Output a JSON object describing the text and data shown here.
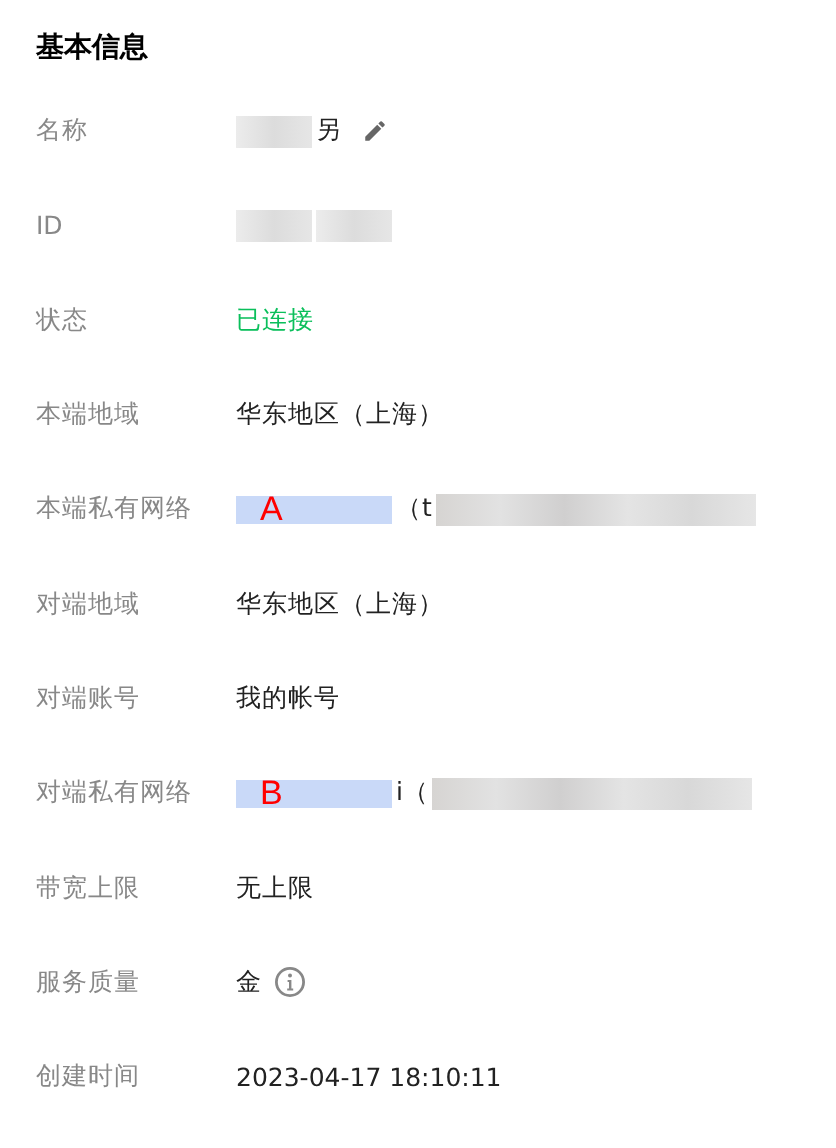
{
  "section_title": "基本信息",
  "rows": [
    {
      "label": "名称",
      "parts": [
        {
          "kind": "blur"
        },
        {
          "kind": "text",
          "text": "另"
        },
        {
          "kind": "edit"
        }
      ]
    },
    {
      "label": "ID",
      "parts": [
        {
          "kind": "blur"
        },
        {
          "kind": "blur"
        }
      ]
    },
    {
      "label": "状态",
      "parts": [
        {
          "kind": "status",
          "text": "已连接"
        }
      ]
    },
    {
      "label": "本端地域",
      "parts": [
        {
          "kind": "text",
          "text": "华东地区（上海）"
        }
      ]
    },
    {
      "label": "本端私有网络",
      "parts": [
        {
          "kind": "tint",
          "marker": "A"
        },
        {
          "kind": "text",
          "text": "（t"
        },
        {
          "kind": "run"
        }
      ]
    },
    {
      "label": "对端地域",
      "parts": [
        {
          "kind": "text",
          "text": "华东地区（上海）"
        }
      ]
    },
    {
      "label": "对端账号",
      "parts": [
        {
          "kind": "text",
          "text": "我的帐号"
        }
      ]
    },
    {
      "label": "对端私有网络",
      "parts": [
        {
          "kind": "tint",
          "marker": "B"
        },
        {
          "kind": "text",
          "text": "i（"
        },
        {
          "kind": "run"
        }
      ]
    },
    {
      "label": "带宽上限",
      "parts": [
        {
          "kind": "text",
          "text": "无上限"
        }
      ]
    },
    {
      "label": "服务质量",
      "parts": [
        {
          "kind": "text",
          "text": "金"
        },
        {
          "kind": "info"
        }
      ]
    },
    {
      "label": "创建时间",
      "parts": [
        {
          "kind": "text",
          "text": "2023-04-17 18:10:11"
        }
      ]
    }
  ]
}
